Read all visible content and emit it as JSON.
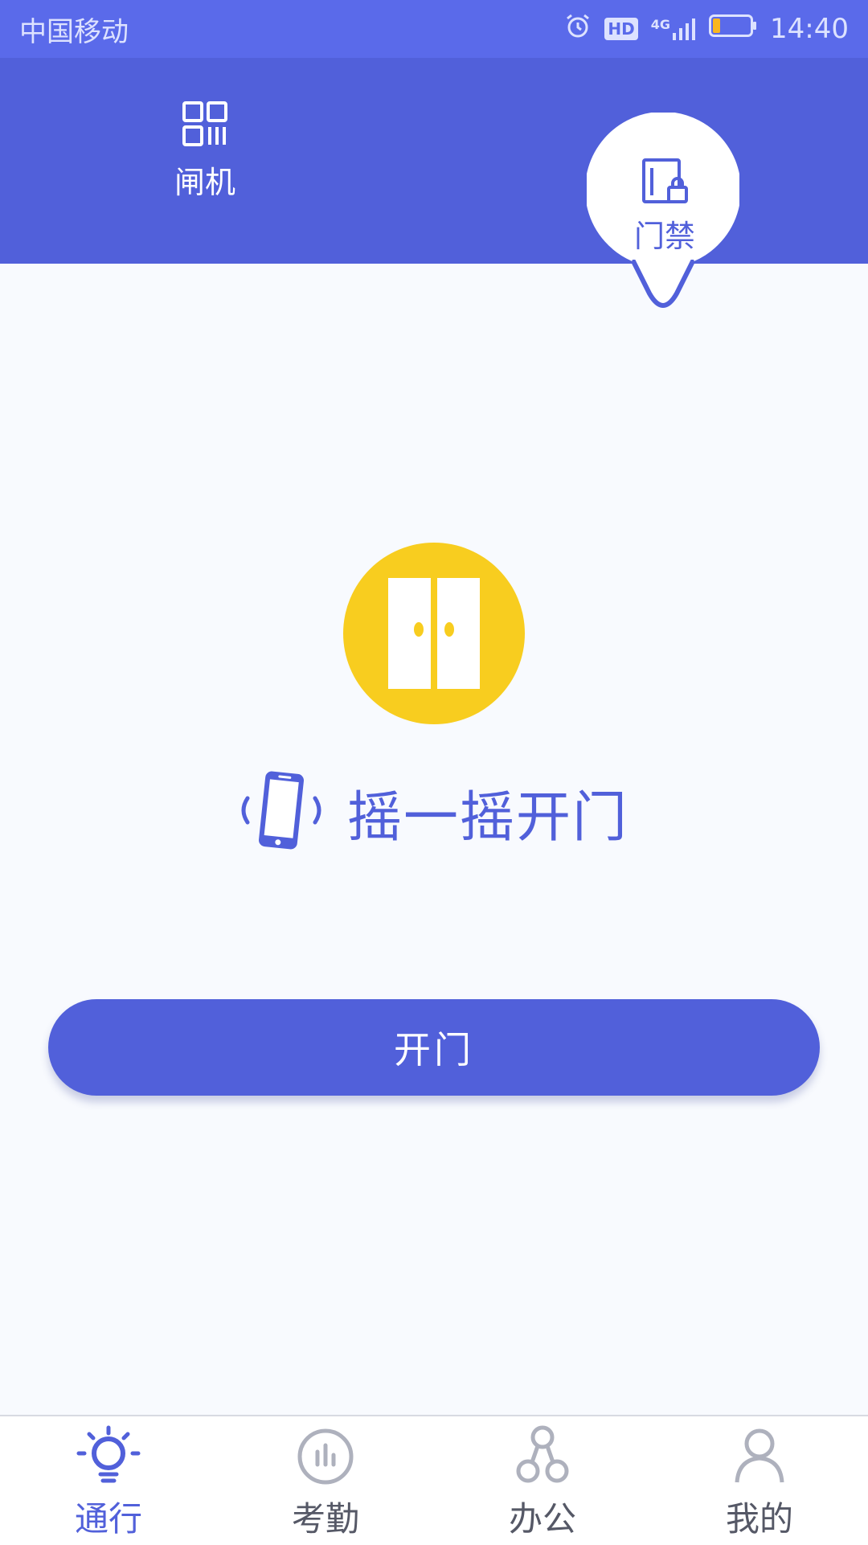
{
  "status_bar": {
    "carrier": "中国移动",
    "network": "4G",
    "hd": "HD",
    "time": "14:40",
    "battery_level": 0.2,
    "icons": [
      "alarm-icon",
      "hd-icon",
      "signal-icon",
      "battery-icon"
    ]
  },
  "tabs": [
    {
      "label": "闸机",
      "icon": "qr-code-icon",
      "active": false
    },
    {
      "label": "门禁",
      "icon": "door-lock-icon",
      "active": true
    }
  ],
  "main": {
    "icon": "door-icon",
    "shake_icon": "phone-vibrate-icon",
    "shake_text": "摇一摇开门",
    "open_button_label": "开门"
  },
  "bottom_nav": [
    {
      "label": "通行",
      "icon": "lightbulb-icon",
      "active": true
    },
    {
      "label": "考勤",
      "icon": "chart-icon",
      "active": false
    },
    {
      "label": "办公",
      "icon": "org-icon",
      "active": false
    },
    {
      "label": "我的",
      "icon": "person-icon",
      "active": false
    }
  ],
  "colors": {
    "primary": "#5160DA",
    "status_bar": "#5A6AEA",
    "accent_yellow": "#F8CD1F",
    "background": "#F8FAFE",
    "inactive": "#555866"
  }
}
